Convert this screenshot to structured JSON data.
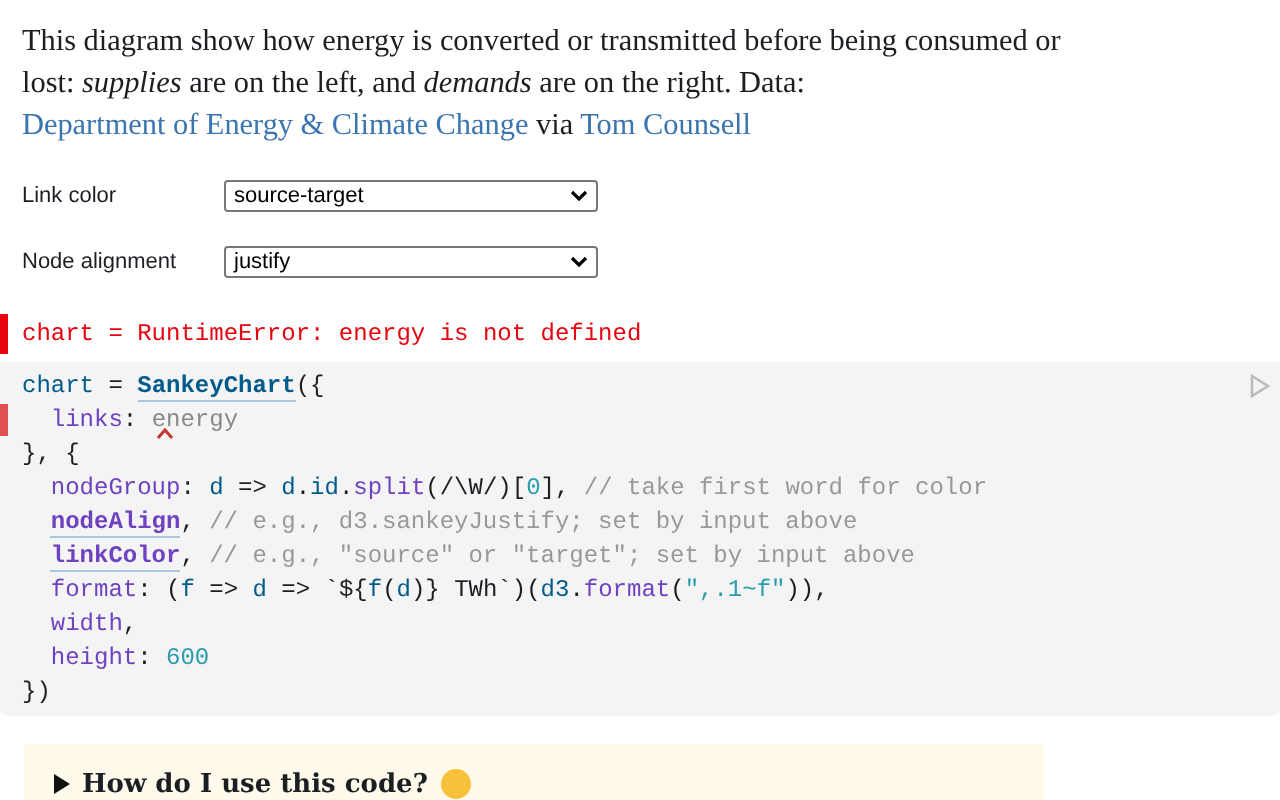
{
  "intro": [
    {
      "kind": "text",
      "text": "This diagram show how energy is converted or transmitted before being consumed or lost: "
    },
    {
      "kind": "italic",
      "text": "supplies"
    },
    {
      "kind": "text",
      "text": " are on the left, and "
    },
    {
      "kind": "italic",
      "text": "demands"
    },
    {
      "kind": "text",
      "text": " are on the right. Data: "
    },
    {
      "kind": "link",
      "text": "Department of Energy & Climate Change"
    },
    {
      "kind": "text",
      "text": " via "
    },
    {
      "kind": "link",
      "text": "Tom Counsell"
    }
  ],
  "inputs": [
    {
      "label": "Link color",
      "value": "source-target"
    },
    {
      "label": "Node alignment",
      "value": "justify"
    }
  ],
  "error": "chart = RuntimeError: energy is not defined",
  "code": [
    {
      "error": false,
      "tokens": [
        {
          "kind": "def",
          "text": "chart"
        },
        {
          "kind": "plain",
          "text": " = "
        },
        {
          "kind": "import",
          "text": "SankeyChart"
        },
        {
          "kind": "plain",
          "text": "({"
        }
      ]
    },
    {
      "error": true,
      "indented": true,
      "tokens": [
        {
          "kind": "prop",
          "text": "links"
        },
        {
          "kind": "plain",
          "text": ": "
        },
        {
          "kind": "undefined",
          "text": "energy"
        }
      ]
    },
    {
      "error": false,
      "tokens": [
        {
          "kind": "plain",
          "text": "}, {"
        }
      ]
    },
    {
      "error": false,
      "indented": true,
      "tokens": [
        {
          "kind": "prop",
          "text": "nodeGroup"
        },
        {
          "kind": "plain",
          "text": ": "
        },
        {
          "kind": "var",
          "text": "d"
        },
        {
          "kind": "plain",
          "text": " => "
        },
        {
          "kind": "var",
          "text": "d"
        },
        {
          "kind": "plain",
          "text": "."
        },
        {
          "kind": "var",
          "text": "id"
        },
        {
          "kind": "plain",
          "text": "."
        },
        {
          "kind": "prop",
          "text": "split"
        },
        {
          "kind": "plain",
          "text": "(/\\W/)["
        },
        {
          "kind": "number",
          "text": "0"
        },
        {
          "kind": "plain",
          "text": "], "
        },
        {
          "kind": "comment",
          "text": "// take first word for color"
        }
      ]
    },
    {
      "error": false,
      "indented": true,
      "tokens": [
        {
          "kind": "ref",
          "text": "nodeAlign"
        },
        {
          "kind": "plain",
          "text": ", "
        },
        {
          "kind": "comment",
          "text": "// e.g., d3.sankeyJustify; set by input above"
        }
      ]
    },
    {
      "error": false,
      "indented": true,
      "tokens": [
        {
          "kind": "ref",
          "text": "linkColor"
        },
        {
          "kind": "plain",
          "text": ", "
        },
        {
          "kind": "comment",
          "text": "// e.g., \"source\" or \"target\"; set by input above"
        }
      ]
    },
    {
      "error": false,
      "indented": true,
      "tokens": [
        {
          "kind": "prop",
          "text": "format"
        },
        {
          "kind": "plain",
          "text": ": ("
        },
        {
          "kind": "var",
          "text": "f"
        },
        {
          "kind": "plain",
          "text": " => "
        },
        {
          "kind": "var",
          "text": "d"
        },
        {
          "kind": "plain",
          "text": " => `${"
        },
        {
          "kind": "var",
          "text": "f"
        },
        {
          "kind": "plain",
          "text": "("
        },
        {
          "kind": "var",
          "text": "d"
        },
        {
          "kind": "plain",
          "text": ")} TWh`)("
        },
        {
          "kind": "var",
          "text": "d3"
        },
        {
          "kind": "plain",
          "text": "."
        },
        {
          "kind": "prop",
          "text": "format"
        },
        {
          "kind": "plain",
          "text": "("
        },
        {
          "kind": "string",
          "text": "\",.1~f\""
        },
        {
          "kind": "plain",
          "text": "))"
        },
        {
          "kind": "plain",
          "text": ","
        }
      ]
    },
    {
      "error": false,
      "indented": true,
      "tokens": [
        {
          "kind": "prop",
          "text": "width"
        },
        {
          "kind": "plain",
          "text": ","
        }
      ]
    },
    {
      "error": false,
      "indented": true,
      "tokens": [
        {
          "kind": "prop",
          "text": "height"
        },
        {
          "kind": "plain",
          "text": ": "
        },
        {
          "kind": "number",
          "text": "600"
        }
      ]
    },
    {
      "error": false,
      "tokens": [
        {
          "kind": "plain",
          "text": "})"
        }
      ]
    }
  ],
  "details": {
    "summary": "How do I use this code?",
    "expanded": false
  }
}
